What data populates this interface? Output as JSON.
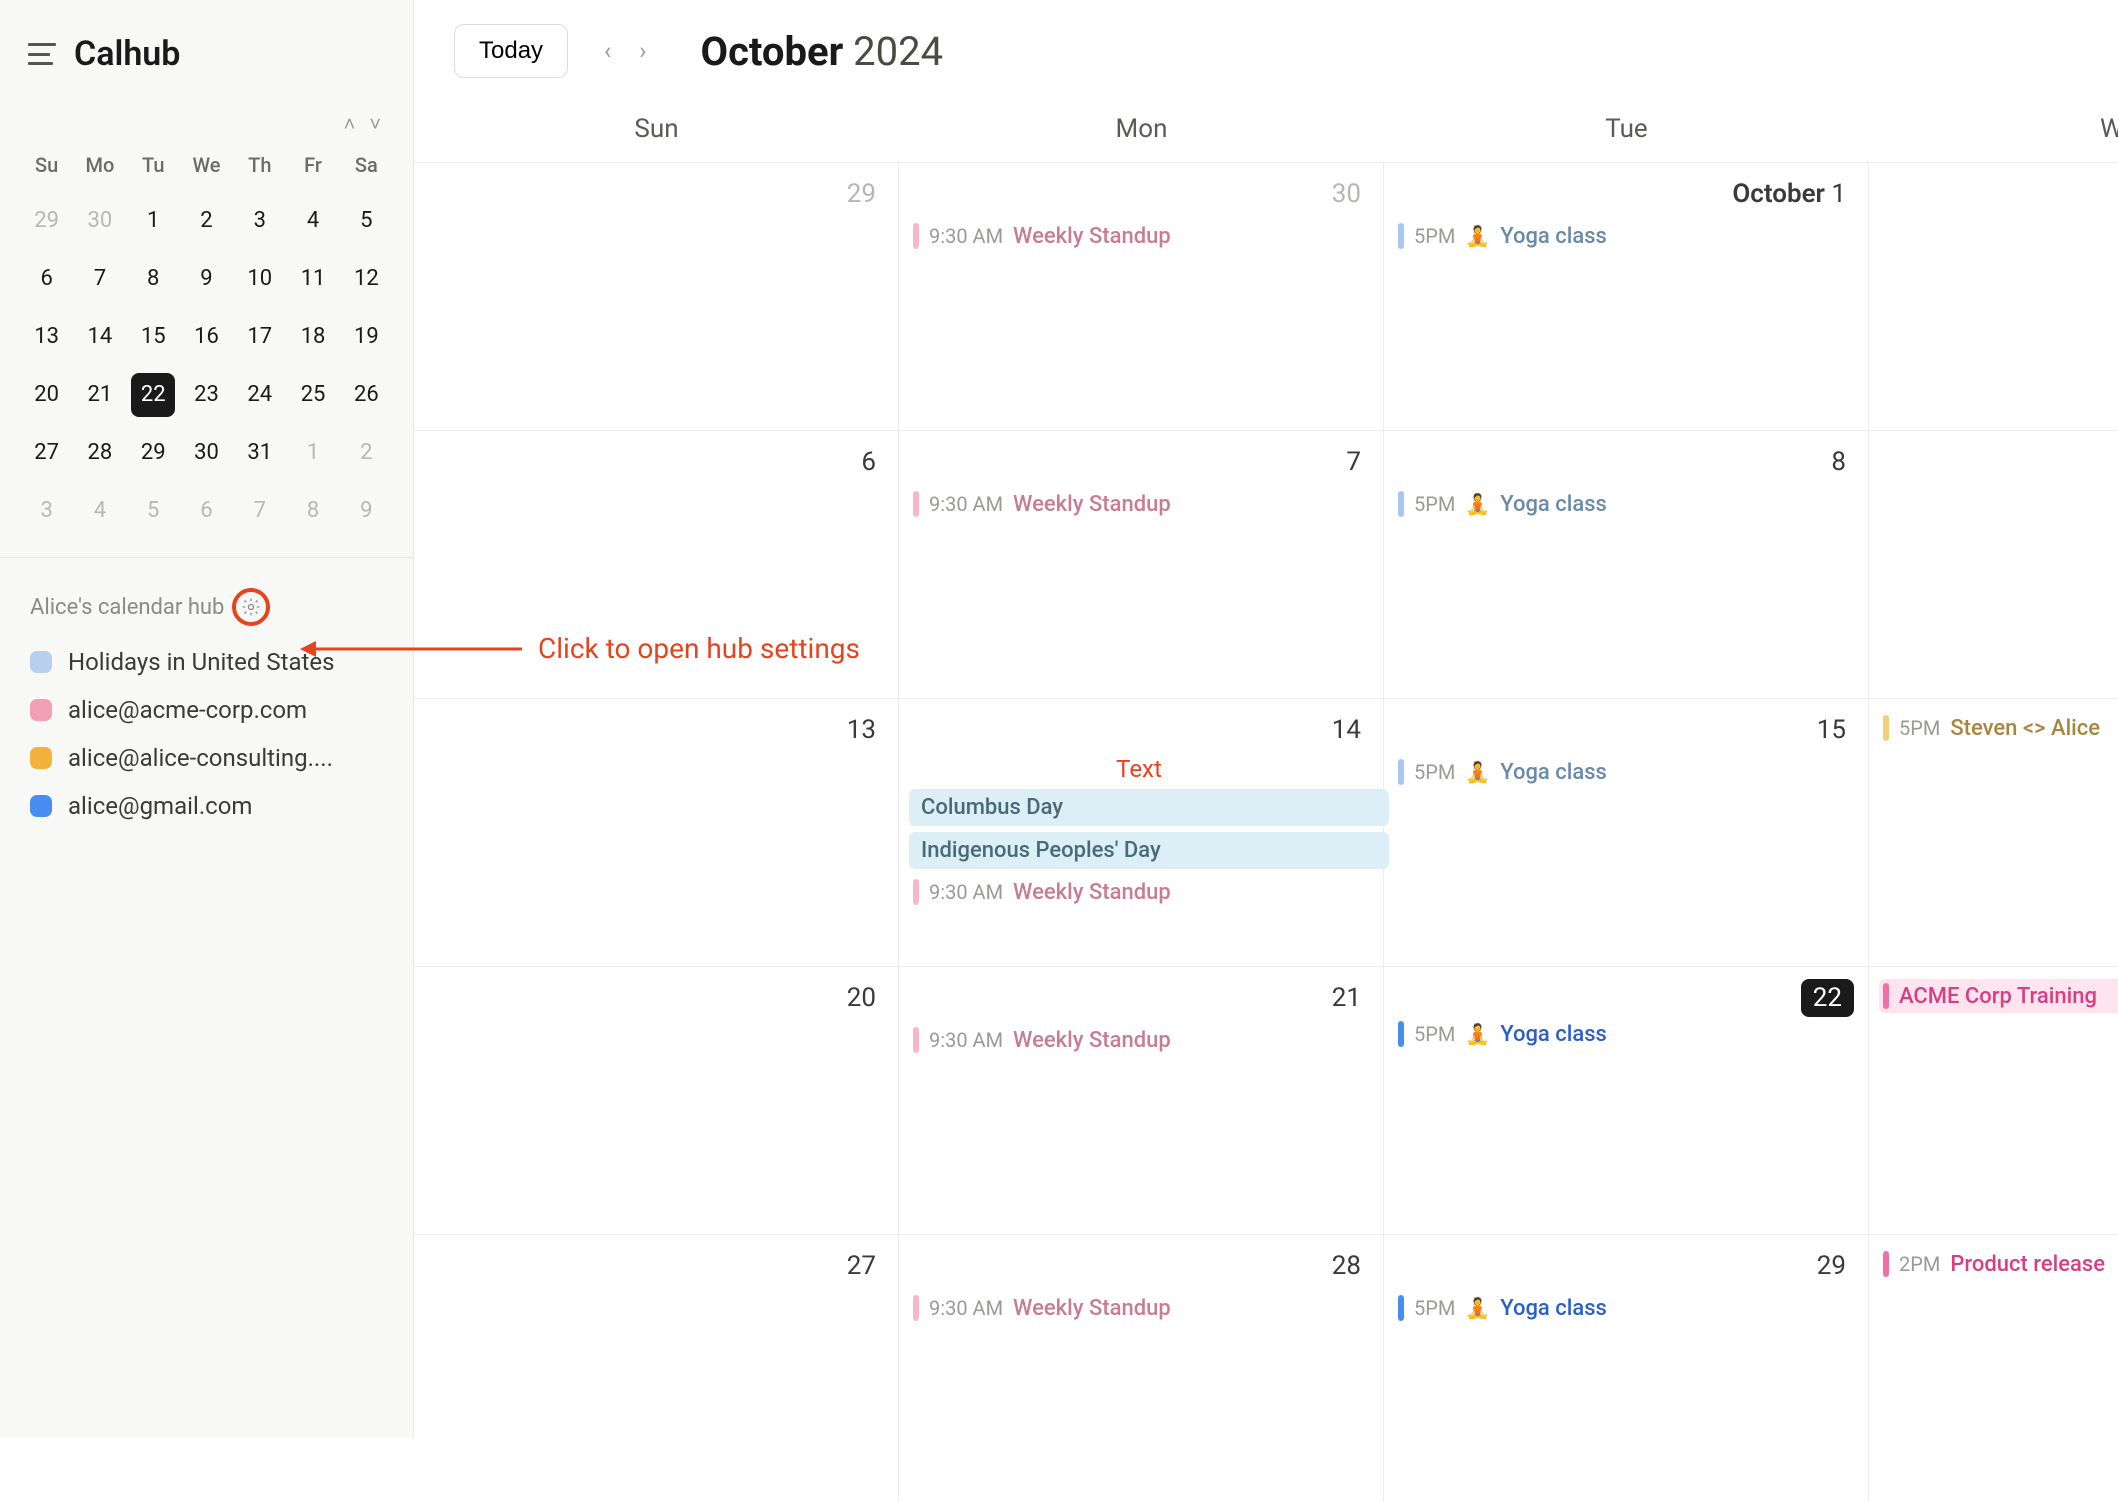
{
  "app": {
    "name": "Calhub"
  },
  "header": {
    "today_label": "Today",
    "month": "October",
    "year": "2024"
  },
  "dow_main": [
    "Sun",
    "Mon",
    "Tue",
    "W"
  ],
  "mini": {
    "dow": [
      "Su",
      "Mo",
      "Tu",
      "We",
      "Th",
      "Fr",
      "Sa"
    ],
    "weeks": [
      [
        {
          "n": "29",
          "o": 1
        },
        {
          "n": "30",
          "o": 1
        },
        {
          "n": "1"
        },
        {
          "n": "2"
        },
        {
          "n": "3"
        },
        {
          "n": "4"
        },
        {
          "n": "5"
        }
      ],
      [
        {
          "n": "6"
        },
        {
          "n": "7"
        },
        {
          "n": "8"
        },
        {
          "n": "9"
        },
        {
          "n": "10"
        },
        {
          "n": "11"
        },
        {
          "n": "12"
        }
      ],
      [
        {
          "n": "13"
        },
        {
          "n": "14"
        },
        {
          "n": "15"
        },
        {
          "n": "16"
        },
        {
          "n": "17"
        },
        {
          "n": "18"
        },
        {
          "n": "19"
        }
      ],
      [
        {
          "n": "20"
        },
        {
          "n": "21"
        },
        {
          "n": "22",
          "sel": 1
        },
        {
          "n": "23"
        },
        {
          "n": "24"
        },
        {
          "n": "25"
        },
        {
          "n": "26"
        }
      ],
      [
        {
          "n": "27"
        },
        {
          "n": "28"
        },
        {
          "n": "29"
        },
        {
          "n": "30"
        },
        {
          "n": "31"
        },
        {
          "n": "1",
          "o": 1
        },
        {
          "n": "2",
          "o": 1
        }
      ],
      [
        {
          "n": "3",
          "o": 1
        },
        {
          "n": "4",
          "o": 1
        },
        {
          "n": "5",
          "o": 1
        },
        {
          "n": "6",
          "o": 1
        },
        {
          "n": "7",
          "o": 1
        },
        {
          "n": "8",
          "o": 1
        },
        {
          "n": "9",
          "o": 1
        }
      ]
    ]
  },
  "hub": {
    "label": "Alice's calendar hub"
  },
  "calendars": [
    {
      "color": "#b8cff0",
      "name": "Holidays in United States"
    },
    {
      "color": "#f19fb3",
      "name": "alice@acme-corp.com"
    },
    {
      "color": "#f3b23b",
      "name": "alice@alice-consulting...."
    },
    {
      "color": "#4a8df0",
      "name": "alice@gmail.com"
    }
  ],
  "annotation": {
    "text": "Click to open hub settings"
  },
  "colors": {
    "pink": "#f7b7c8",
    "pink_text": "#c77d92",
    "blue": "#a7c7f0",
    "blue_text": "#6a8aa8",
    "yellow": "#f3cf7a",
    "yellow_text": "#a8863d",
    "hotpink": "#f06fa8",
    "hotpink_text": "#d73e83",
    "yoga_active": "#2d5fc9",
    "allday_bg": "#dceef6"
  },
  "weeks": [
    {
      "days": [
        {
          "num": "29",
          "other": true,
          "events": []
        },
        {
          "num": "30",
          "other": true,
          "events": [
            {
              "time": "9:30 AM",
              "title": "Weekly Standup",
              "barColor": "#f7b7c8",
              "titleColor": "#c77d92"
            }
          ]
        },
        {
          "num": "1",
          "lead": "October",
          "events": [
            {
              "time": "5PM",
              "emoji": "🧘",
              "title": "Yoga class",
              "barColor": "#a7c7f0",
              "titleColor": "#6a8aa8"
            }
          ]
        },
        {
          "spill": true
        }
      ]
    },
    {
      "days": [
        {
          "num": "6",
          "events": []
        },
        {
          "num": "7",
          "events": [
            {
              "time": "9:30 AM",
              "title": "Weekly Standup",
              "barColor": "#f7b7c8",
              "titleColor": "#c77d92"
            }
          ]
        },
        {
          "num": "8",
          "events": [
            {
              "time": "5PM",
              "emoji": "🧘",
              "title": "Yoga class",
              "barColor": "#a7c7f0",
              "titleColor": "#6a8aa8"
            }
          ]
        },
        {
          "spill": true
        }
      ]
    },
    {
      "days": [
        {
          "num": "13",
          "events": []
        },
        {
          "num": "14",
          "inlinetxt": "Text",
          "events": [
            {
              "allday": true,
              "title": "Columbus Day"
            },
            {
              "allday": true,
              "title": "Indigenous Peoples' Day"
            },
            {
              "time": "9:30 AM",
              "title": "Weekly Standup",
              "barColor": "#f7b7c8",
              "titleColor": "#c77d92"
            }
          ]
        },
        {
          "num": "15",
          "events": [
            {
              "time": "5PM",
              "emoji": "🧘",
              "title": "Yoga class",
              "barColor": "#a7c7f0",
              "titleColor": "#6a8aa8"
            }
          ]
        },
        {
          "spill": true,
          "events": [
            {
              "time": "5PM",
              "title": "Steven <> Alice",
              "barColor": "#f3cf7a",
              "titleColor": "#a8863d"
            }
          ]
        }
      ]
    },
    {
      "days": [
        {
          "num": "20",
          "events": []
        },
        {
          "num": "21",
          "events": [
            {
              "time": "9:30 AM",
              "title": "Weekly Standup",
              "barColor": "#f7b7c8",
              "titleColor": "#c77d92"
            }
          ]
        },
        {
          "num": "22",
          "today": true,
          "events": [
            {
              "time": "5PM",
              "emoji": "🧘",
              "title": "Yoga class",
              "barColor": "#4a8df0",
              "titleColor": "#2d5fc9"
            }
          ]
        },
        {
          "spill": true,
          "events": [
            {
              "bannerColor": "#f06fa8",
              "bannerBg": "#fde4ef",
              "title": "ACME Corp Training",
              "titleColor": "#d73e83"
            }
          ]
        }
      ]
    },
    {
      "days": [
        {
          "num": "27",
          "events": []
        },
        {
          "num": "28",
          "events": [
            {
              "time": "9:30 AM",
              "title": "Weekly Standup",
              "barColor": "#f7b7c8",
              "titleColor": "#c77d92"
            }
          ]
        },
        {
          "num": "29",
          "events": [
            {
              "time": "5PM",
              "emoji": "🧘",
              "title": "Yoga class",
              "barColor": "#4a8df0",
              "titleColor": "#2d5fc9"
            }
          ]
        },
        {
          "spill": true,
          "events": [
            {
              "time": "2PM",
              "title": "Product release",
              "barColor": "#f06fa8",
              "titleColor": "#d73e83"
            }
          ]
        }
      ]
    }
  ]
}
